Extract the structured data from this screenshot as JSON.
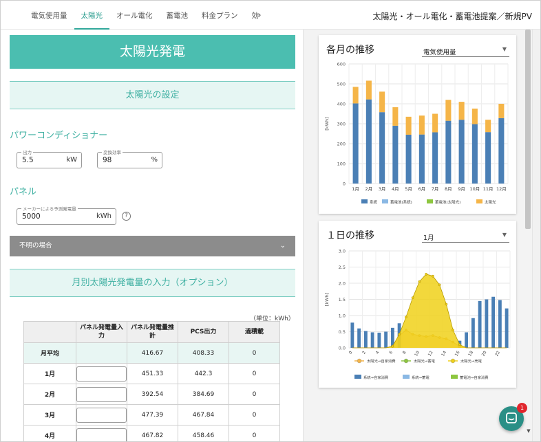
{
  "tabs": [
    {
      "label": "電気使用量"
    },
    {
      "label": "太陽光"
    },
    {
      "label": "オール電化"
    },
    {
      "label": "蓄電池"
    },
    {
      "label": "料金プラン"
    },
    {
      "label": "効"
    }
  ],
  "page_title": "太陽光・オール電化・蓄電池提案／新規PV",
  "left": {
    "hero_title": "太陽光発電",
    "section_settings": "太陽光の設定",
    "pcs_heading": "パワーコンディショナー",
    "output_label": "出力",
    "output_value": "5.5",
    "output_unit": "kW",
    "efficiency_label": "変換効率",
    "efficiency_value": "98",
    "efficiency_unit": "%",
    "panel_heading": "パネル",
    "maker_label": "メーカーによる予測発電量",
    "maker_value": "5000",
    "maker_unit": "kWh",
    "help_icon": "?",
    "accordion_label": "不明の場合",
    "section_monthly": "月別太陽光発電量の入力（オプション）",
    "unit_note": "（単位：kWh）",
    "table": {
      "headers": [
        "",
        "パネル発電量入力",
        "パネル発電量推計",
        "PCS出力",
        "過積載"
      ],
      "rows": [
        {
          "label": "月平均",
          "estimate": "416.67",
          "pcs": "408.33",
          "over": "0"
        },
        {
          "label": "1月",
          "estimate": "451.33",
          "pcs": "442.3",
          "over": "0"
        },
        {
          "label": "2月",
          "estimate": "392.54",
          "pcs": "384.69",
          "over": "0"
        },
        {
          "label": "3月",
          "estimate": "477.39",
          "pcs": "467.84",
          "over": "0"
        },
        {
          "label": "4月",
          "estimate": "467.82",
          "pcs": "458.46",
          "over": "0"
        }
      ]
    }
  },
  "monthly_card": {
    "title": "各月の推移",
    "select_value": "電気使用量"
  },
  "daily_card": {
    "title": "１日の推移",
    "select_value": "1月"
  },
  "chat_badge": "1",
  "colors": {
    "accent": "#4bbeb0",
    "grid_blue": "#4a7fb5",
    "grid_light": "#8ab8e4",
    "battery_green": "#8dc63f",
    "solar_orange": "#f5b548",
    "solar_yellow": "#f0d11a"
  },
  "chart_data": [
    {
      "type": "bar",
      "title": "各月の推移",
      "ylabel": "[kWh]",
      "ylim": [
        0,
        600
      ],
      "yticks": [
        "0",
        "100",
        "200",
        "300",
        "400",
        "500",
        "600"
      ],
      "stacked": true,
      "categories": [
        "1月",
        "2月",
        "3月",
        "4月",
        "5月",
        "6月",
        "7月",
        "8月",
        "9月",
        "10月",
        "11月",
        "12月"
      ],
      "series": [
        {
          "name": "系統",
          "color": "#4a7fb5",
          "values": [
            402,
            422,
            358,
            290,
            245,
            246,
            257,
            315,
            320,
            298,
            258,
            328
          ]
        },
        {
          "name": "蓄電池(系統)",
          "color": "#8ab8e4",
          "values": [
            0,
            0,
            0,
            0,
            0,
            0,
            0,
            0,
            0,
            0,
            0,
            0
          ]
        },
        {
          "name": "蓄電池(太陽光)",
          "color": "#8dc63f",
          "values": [
            0,
            0,
            0,
            0,
            0,
            0,
            0,
            0,
            0,
            0,
            0,
            0
          ]
        },
        {
          "name": "太陽光",
          "color": "#f5b548",
          "values": [
            83,
            94,
            103,
            93,
            90,
            95,
            93,
            105,
            90,
            78,
            62,
            72
          ]
        }
      ],
      "legend_position": "bottom"
    },
    {
      "type": "bar",
      "title": "１日の推移",
      "ylabel": "[kWh]",
      "ylim": [
        0,
        3.0
      ],
      "yticks": [
        "0.0",
        "0.5",
        "1.0",
        "1.5",
        "2.0",
        "2.5",
        "3.0"
      ],
      "x": [
        0,
        1,
        2,
        3,
        4,
        5,
        6,
        7,
        8,
        9,
        10,
        11,
        12,
        13,
        14,
        15,
        16,
        17,
        18,
        19,
        20,
        21,
        22,
        23
      ],
      "xticks": [
        "0",
        "2",
        "4",
        "6",
        "8",
        "10",
        "12",
        "14",
        "16",
        "18",
        "20",
        "22"
      ],
      "series": [
        {
          "name": "系統→自家消費",
          "type": "bar",
          "color": "#4a7fb5",
          "values": [
            0.78,
            0.6,
            0.52,
            0.48,
            0.47,
            0.5,
            0.62,
            0.76,
            0,
            0,
            0,
            0,
            0,
            0,
            0,
            0,
            0.22,
            0.48,
            0.92,
            1.45,
            1.5,
            1.58,
            1.48,
            1.22
          ]
        },
        {
          "name": "系統→蓄電",
          "type": "bar",
          "color": "#8ab8e4",
          "values": [
            0,
            0,
            0,
            0,
            0,
            0,
            0,
            0,
            0,
            0,
            0,
            0,
            0,
            0,
            0,
            0,
            0,
            0,
            0,
            0,
            0,
            0,
            0,
            0
          ]
        },
        {
          "name": "蓄電池→自家消費",
          "type": "bar",
          "color": "#8dc63f",
          "values": [
            0,
            0,
            0,
            0,
            0,
            0,
            0,
            0,
            0,
            0,
            0,
            0,
            0,
            0,
            0,
            0,
            0,
            0,
            0,
            0,
            0,
            0,
            0,
            0
          ]
        },
        {
          "name": "太陽光→自家消費",
          "type": "area",
          "color": "#f5b548",
          "values": [
            0,
            0,
            0,
            0,
            0,
            0,
            0.05,
            0.38,
            0.55,
            0.42,
            0.38,
            0.35,
            0.38,
            0.32,
            0.28,
            0.18,
            0.04,
            0,
            0,
            0,
            0,
            0,
            0,
            0
          ]
        },
        {
          "name": "太陽光→蓄電",
          "type": "line",
          "color": "#8dc63f",
          "values": [
            0,
            0,
            0,
            0,
            0,
            0,
            0,
            0,
            0,
            0,
            0,
            0,
            0,
            0,
            0,
            0,
            0,
            0,
            0,
            0,
            0,
            0,
            0,
            0
          ]
        },
        {
          "name": "太陽光→売電",
          "type": "area",
          "color": "#f0d11a",
          "values": [
            0,
            0,
            0,
            0,
            0,
            0,
            0.05,
            0.42,
            0.95,
            1.55,
            2.05,
            2.28,
            2.22,
            1.95,
            1.35,
            0.55,
            0.1,
            0,
            0,
            0,
            0,
            0,
            0,
            0
          ]
        }
      ],
      "legend_position": "bottom"
    }
  ]
}
